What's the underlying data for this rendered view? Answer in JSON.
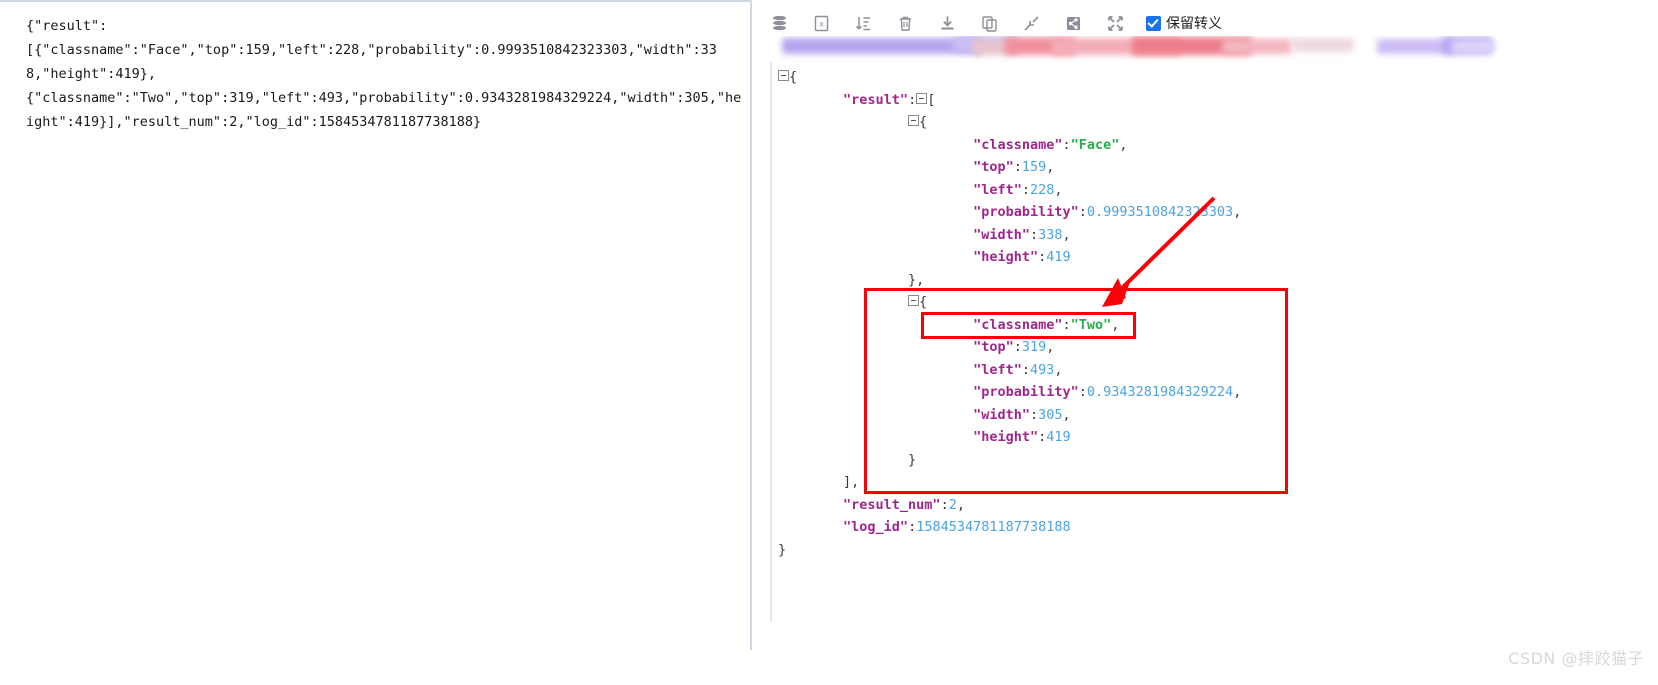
{
  "raw_panel": {
    "raw_text": "{\"result\":\n[{\"classname\":\"Face\",\"top\":159,\"left\":228,\"probability\":0.9993510842323303,\"width\":338,\"height\":419},\n{\"classname\":\"Two\",\"top\":319,\"left\":493,\"probability\":0.9343281984329224,\"width\":305,\"height\":419}],\"result_num\":2,\"log_id\":1584534781187738188}"
  },
  "toolbar": {
    "buttons": [
      {
        "name": "database-icon",
        "title": "database"
      },
      {
        "name": "excel-export-icon",
        "title": "export-excel"
      },
      {
        "name": "sort-icon",
        "title": "sort"
      },
      {
        "name": "delete-icon",
        "title": "delete"
      },
      {
        "name": "download-icon",
        "title": "download"
      },
      {
        "name": "copy-icon",
        "title": "copy"
      },
      {
        "name": "collapse-icon",
        "title": "collapse"
      },
      {
        "name": "share-icon",
        "title": "share"
      },
      {
        "name": "expand-icon",
        "title": "expand"
      }
    ],
    "checkbox": {
      "label": "保留转义",
      "checked": true,
      "color": "#1a73e8"
    }
  },
  "redacted_strip": {
    "note": "blurred redacted toolbar row",
    "colors": [
      "#b9a8f0",
      "#f6a0b0",
      "#ef6d78",
      "#c8b8f5",
      "#dcd2fb"
    ]
  },
  "json_tree": {
    "lines": [
      {
        "indent": 0,
        "toggle": true,
        "content": "{"
      },
      {
        "indent": 1,
        "toggle": true,
        "key": "result",
        "after": "["
      },
      {
        "indent": 2,
        "toggle": true,
        "content": "{"
      },
      {
        "indent": 3,
        "key": "classname",
        "string": "Face",
        "comma": true
      },
      {
        "indent": 3,
        "key": "top",
        "number": "159",
        "comma": true
      },
      {
        "indent": 3,
        "key": "left",
        "number": "228",
        "comma": true
      },
      {
        "indent": 3,
        "key": "probability",
        "number": "0.9993510842323303",
        "comma": true
      },
      {
        "indent": 3,
        "key": "width",
        "number": "338",
        "comma": true
      },
      {
        "indent": 3,
        "key": "height",
        "number": "419",
        "comma": false
      },
      {
        "indent": 2,
        "content": "},"
      },
      {
        "indent": 2,
        "toggle": true,
        "content": "{"
      },
      {
        "indent": 3,
        "key": "classname",
        "string": "Two",
        "comma": true
      },
      {
        "indent": 3,
        "key": "top",
        "number": "319",
        "comma": true
      },
      {
        "indent": 3,
        "key": "left",
        "number": "493",
        "comma": true
      },
      {
        "indent": 3,
        "key": "probability",
        "number": "0.9343281984329224",
        "comma": true
      },
      {
        "indent": 3,
        "key": "width",
        "number": "305",
        "comma": true
      },
      {
        "indent": 3,
        "key": "height",
        "number": "419",
        "comma": false
      },
      {
        "indent": 2,
        "content": "}"
      },
      {
        "indent": 1,
        "content": "],"
      },
      {
        "indent": 1,
        "key": "result_num",
        "number": "2",
        "comma": true
      },
      {
        "indent": 1,
        "key": "log_id",
        "number": "1584534781187738188",
        "comma": false
      },
      {
        "indent": 0,
        "content": "}"
      }
    ]
  },
  "annotations": {
    "highlight_color": "#fb0007",
    "big_box_label": "second-result-object-highlight",
    "small_box_label": "classname-two-highlight",
    "arrow_label": "pointer-arrow"
  },
  "watermark": {
    "text": "CSDN @摔跤猫子"
  }
}
